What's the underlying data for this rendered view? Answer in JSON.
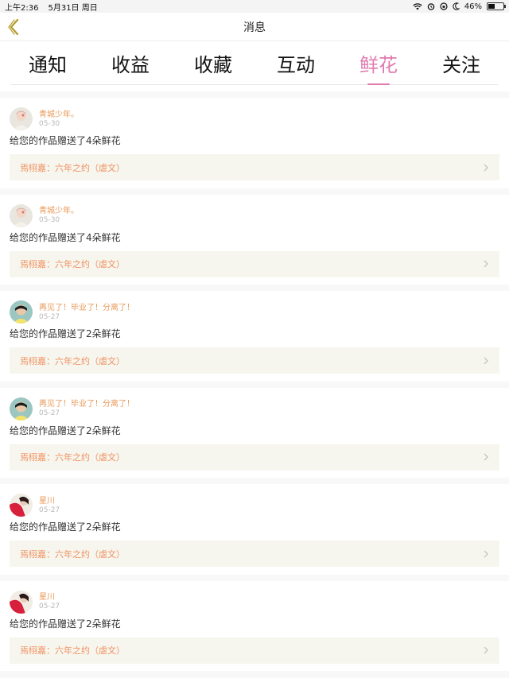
{
  "status": {
    "time": "上午2:36",
    "date": "5月31日 周日",
    "battery": "46%",
    "battery_level": 0.46
  },
  "nav": {
    "title": "消息"
  },
  "tabs": [
    {
      "label": "通知",
      "active": false
    },
    {
      "label": "收益",
      "active": false
    },
    {
      "label": "收藏",
      "active": false
    },
    {
      "label": "互动",
      "active": false
    },
    {
      "label": "鲜花",
      "active": true
    },
    {
      "label": "关注",
      "active": false
    }
  ],
  "items": [
    {
      "user": "青城少年。",
      "date": "05-30",
      "message": "给您的作品赠送了4朵鲜花",
      "work": "焉栩嘉：六年之约（虐文）",
      "avatar": "avatar-1"
    },
    {
      "user": "青城少年。",
      "date": "05-30",
      "message": "给您的作品赠送了4朵鲜花",
      "work": "焉栩嘉：六年之约（虐文）",
      "avatar": "avatar-1"
    },
    {
      "user": "再见了！毕业了！分离了！",
      "date": "05-27",
      "message": "给您的作品赠送了2朵鲜花",
      "work": "焉栩嘉：六年之约（虐文）",
      "avatar": "avatar-2"
    },
    {
      "user": "再见了！毕业了！分离了！",
      "date": "05-27",
      "message": "给您的作品赠送了2朵鲜花",
      "work": "焉栩嘉：六年之约（虐文）",
      "avatar": "avatar-2"
    },
    {
      "user": "星川",
      "date": "05-27",
      "message": "给您的作品赠送了2朵鲜花",
      "work": "焉栩嘉：六年之约（虐文）",
      "avatar": "avatar-3"
    },
    {
      "user": "星川",
      "date": "05-27",
      "message": "给您的作品赠送了2朵鲜花",
      "work": "焉栩嘉：六年之约（虐文）",
      "avatar": "avatar-3"
    }
  ],
  "colors": {
    "accent": "#e07bb0",
    "username": "#e89a5a",
    "work_title": "#f09060",
    "back_arrow": "#b49a2a"
  }
}
